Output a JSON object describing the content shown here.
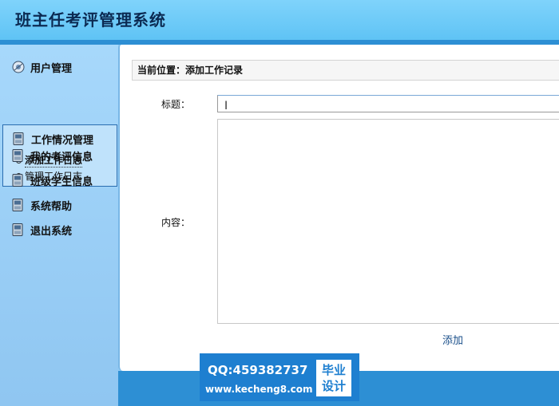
{
  "app": {
    "title": "班主任考评管理系统"
  },
  "sidebar": {
    "items": [
      {
        "label": "用户管理",
        "icon": "user-globe-icon"
      },
      {
        "label": "工作情况管理",
        "icon": "phone-icon",
        "expanded": true,
        "children": [
          {
            "label": "添加工作日志",
            "active": true
          },
          {
            "label": "管理工作日志",
            "active": false
          }
        ]
      },
      {
        "label": "我的考评信息",
        "icon": "phone-icon"
      },
      {
        "label": "班级学生信息",
        "icon": "phone-icon"
      },
      {
        "label": "系统帮助",
        "icon": "phone-icon"
      },
      {
        "label": "退出系统",
        "icon": "phone-icon"
      }
    ]
  },
  "main": {
    "breadcrumb": "当前位置：添加工作记录",
    "form": {
      "title_label": "标题：",
      "title_value": "",
      "content_label": "内容：",
      "content_value": "",
      "submit_label": "添加"
    }
  },
  "watermark": {
    "qq": "QQ:459382737",
    "url": "www.kecheng8.com",
    "badge_line1": "毕业",
    "badge_line2": "设计"
  },
  "colors": {
    "header": "#5fc3f5",
    "band": "#2d8fd4",
    "sidebar": "#a7d8fb",
    "link": "#1a4f8a"
  }
}
